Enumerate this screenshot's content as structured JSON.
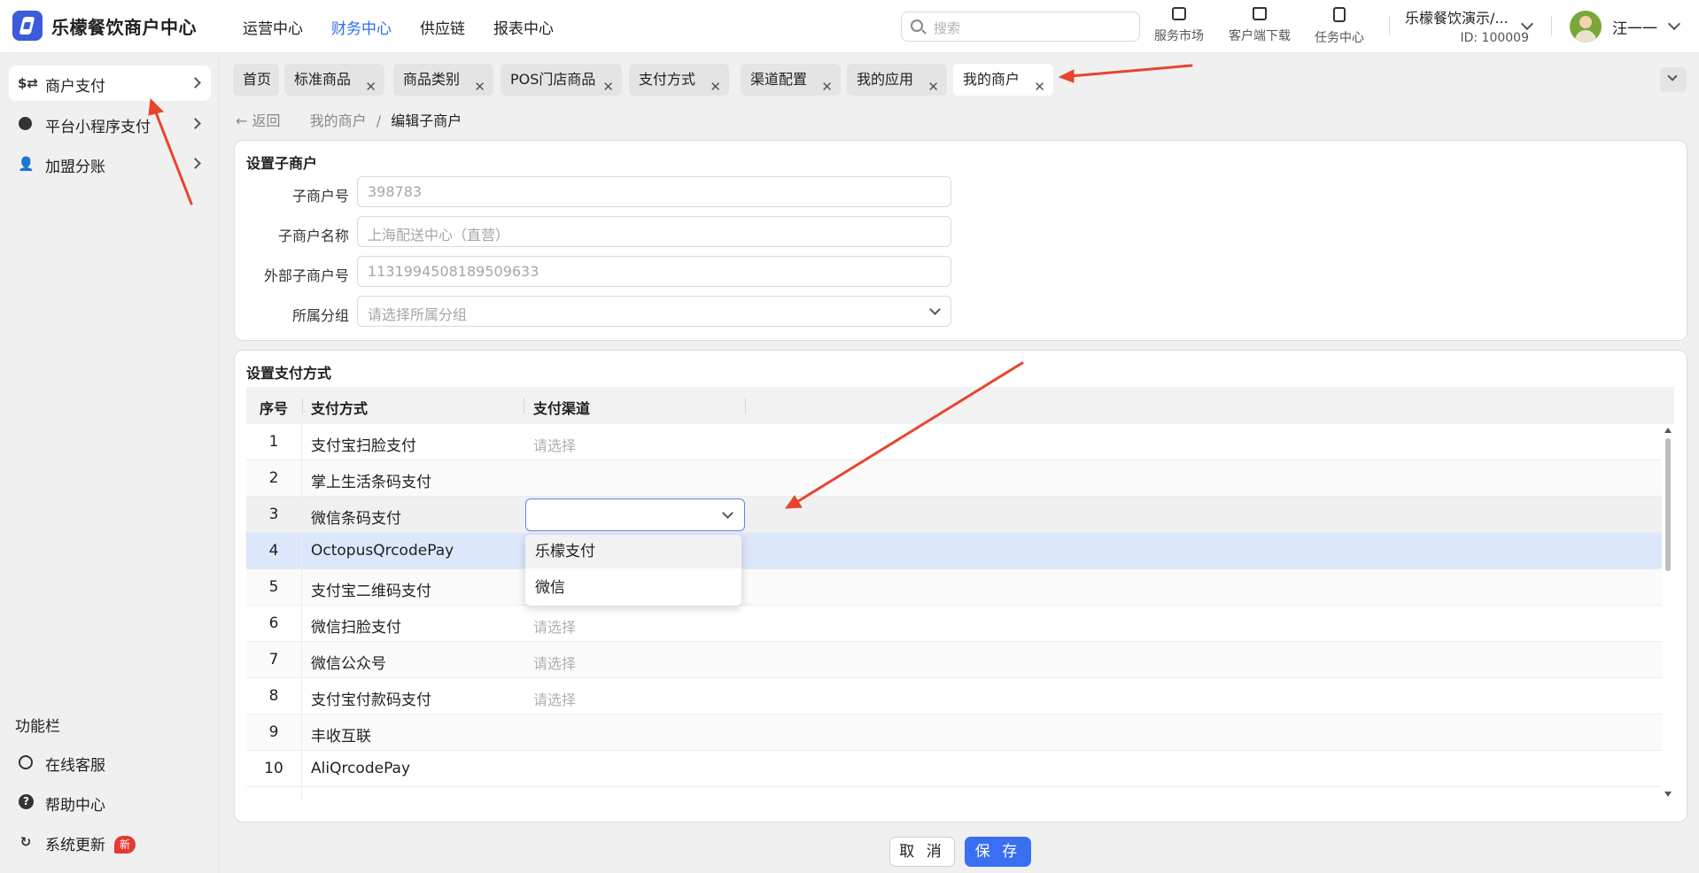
{
  "header": {
    "app_title": "乐檬餐饮商户中心",
    "nav": [
      "运营中心",
      "财务中心",
      "供应链",
      "报表中心"
    ],
    "active_nav": "财务中心",
    "search_placeholder": "搜索",
    "shortcuts": [
      {
        "label": "服务市场",
        "icon": "store-icon"
      },
      {
        "label": "客户端下载",
        "icon": "folder-download-icon"
      },
      {
        "label": "任务中心",
        "icon": "clipboard-check-icon"
      }
    ],
    "org_name": "乐檬餐饮演示/...",
    "org_id": "ID: 100009",
    "user_name": "汪一一"
  },
  "sidebar": {
    "items": [
      {
        "label": "商户支付",
        "icon": "exchange-icon",
        "active": true
      },
      {
        "label": "平台小程序支付",
        "icon": "mini-program-icon",
        "active": false
      },
      {
        "label": "加盟分账",
        "icon": "user-add-icon",
        "active": false
      }
    ],
    "section_label": "功能栏",
    "tools": [
      {
        "label": "在线客服",
        "icon": "headset-icon"
      },
      {
        "label": "帮助中心",
        "icon": "help-icon"
      },
      {
        "label": "系统更新",
        "icon": "refresh-icon",
        "badge": "新"
      }
    ]
  },
  "tabs": [
    {
      "label": "首页",
      "closable": false
    },
    {
      "label": "标准商品",
      "closable": true
    },
    {
      "label": "商品类别",
      "closable": true
    },
    {
      "label": "POS门店商品",
      "closable": true
    },
    {
      "label": "支付方式",
      "closable": true
    },
    {
      "label": "渠道配置",
      "closable": true
    },
    {
      "label": "我的应用",
      "closable": true
    },
    {
      "label": "我的商户",
      "closable": true,
      "active": true
    }
  ],
  "breadcrumb": {
    "back": "返回",
    "parent": "我的商户",
    "separator": "/",
    "current": "编辑子商户"
  },
  "sub_merchant": {
    "title": "设置子商户",
    "fields": [
      {
        "label": "子商户号",
        "value": "398783"
      },
      {
        "label": "子商户名称",
        "value": "上海配送中心（直营）"
      },
      {
        "label": "外部子商户号",
        "value": "1131994508189509633"
      },
      {
        "label": "所属分组",
        "value": "请选择所属分组"
      }
    ]
  },
  "payment": {
    "title": "设置支付方式",
    "columns": [
      "序号",
      "支付方式",
      "支付渠道"
    ],
    "rows": [
      {
        "no": "1",
        "method": "支付宝扫脸支付",
        "channel": "请选择"
      },
      {
        "no": "2",
        "method": "掌上生活条码支付",
        "channel": ""
      },
      {
        "no": "3",
        "method": "微信条码支付",
        "channel": ""
      },
      {
        "no": "4",
        "method": "OctopusQrcodePay",
        "channel": ""
      },
      {
        "no": "5",
        "method": "支付宝二维码支付",
        "channel": ""
      },
      {
        "no": "6",
        "method": "微信扫脸支付",
        "channel": "请选择"
      },
      {
        "no": "7",
        "method": "微信公众号",
        "channel": "请选择"
      },
      {
        "no": "8",
        "method": "支付宝付款码支付",
        "channel": "请选择"
      },
      {
        "no": "9",
        "method": "丰收互联",
        "channel": ""
      },
      {
        "no": "10",
        "method": "AliQrcodePay",
        "channel": ""
      }
    ],
    "dropdown_options": [
      "乐檬支付",
      "微信"
    ]
  },
  "footer": {
    "cancel": "取 消",
    "save": "保 存"
  },
  "colors": {
    "accent": "#3a6ff2",
    "annotation_arrow": "#e8442e",
    "selected_row": "#dde7fb"
  }
}
